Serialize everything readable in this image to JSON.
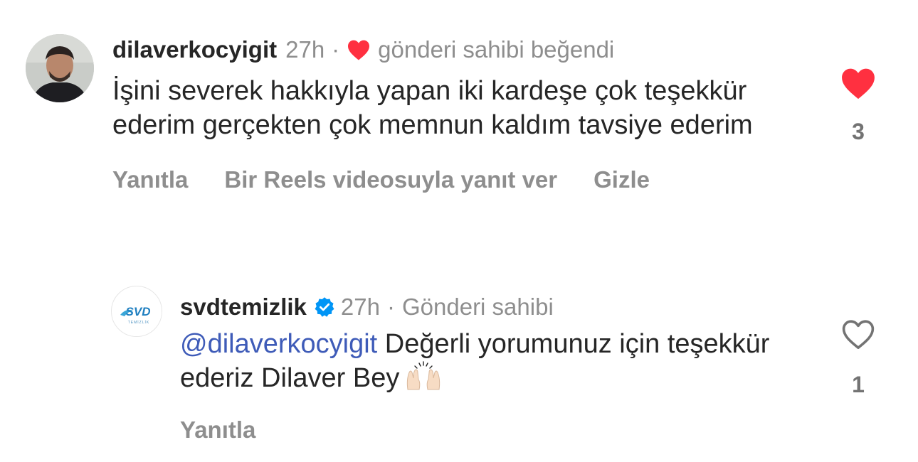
{
  "comments": [
    {
      "username": "dilaverkocyigit",
      "time": "27h",
      "liked_note": "gönderi sahibi beğendi",
      "text": "İşini severek hakkıyla yapan iki kardeşe çok teşekkür ederim gerçekten çok memnun kaldım tavsiye ederim",
      "like_count": "3",
      "liked": true,
      "actions": [
        "Yanıtla",
        "Bir Reels videosuyla yanıt ver",
        "Gizle"
      ]
    },
    {
      "username": "svdtemizlik",
      "verified": true,
      "time": "27h",
      "owner_note": "Gönderi sahibi",
      "mention": "@dilaverkocyigit",
      "text": "Değerli yorumunuz için teşekkür ederiz Dilaver Bey",
      "emoji": "raising-hands-emoji",
      "like_count": "1",
      "liked": false,
      "actions": [
        "Yanıtla"
      ],
      "avatar_logo_text": "SVD TEMİZLİK"
    }
  ],
  "colors": {
    "heart_red": "#ff3040",
    "verified_blue": "#0095f6",
    "mention": "#3e5bb8",
    "muted": "#8e8e8e"
  },
  "icons": {
    "separator_dot": "·",
    "liked_heart": "heart-filled-icon",
    "empty_heart": "heart-outline-icon",
    "verified": "verified-badge-icon"
  }
}
